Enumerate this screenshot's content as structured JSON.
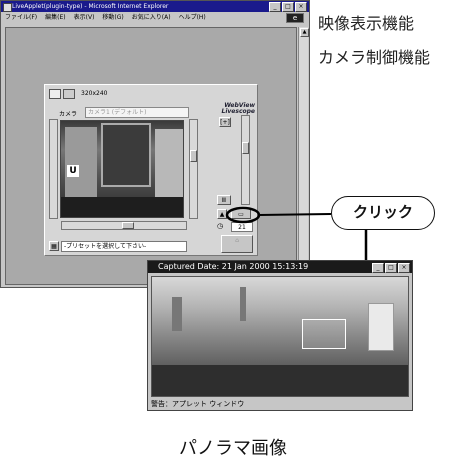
{
  "ie_window": {
    "title": "LiveApplet(plugin-type) - Microsoft Internet Explorer",
    "menu": [
      "ファイル(F)",
      "編集(E)",
      "表示(V)",
      "移動(G)",
      "お気に入り(A)",
      "ヘルプ(H)"
    ],
    "window_buttons": [
      "_",
      "□",
      "×"
    ]
  },
  "applet": {
    "size_label": "320x240",
    "camera_label": "カメラ",
    "camera_value": "カメラ1 (デフォルト)",
    "logo_line1": "WebView",
    "logo_line2": "Livescope",
    "zoom_value": "21",
    "preset_placeholder": "-プリセットを選択して下さい-"
  },
  "annotations": {
    "feature_video": "映像表示機能",
    "feature_camera": "カメラ制御機能",
    "click": "クリック",
    "panorama": "パノラマ画像"
  },
  "panorama_window": {
    "title": "Captured Date:  21 Jan 2000 15:13:19",
    "status": "警告：アプレット ウィンドウ",
    "window_buttons": [
      "_",
      "□",
      "×"
    ]
  },
  "colors": {
    "title_bar_blue": "#1a1a8c",
    "panorama_title": "#1a1a1a",
    "window_gray": "#c6c6c6"
  }
}
